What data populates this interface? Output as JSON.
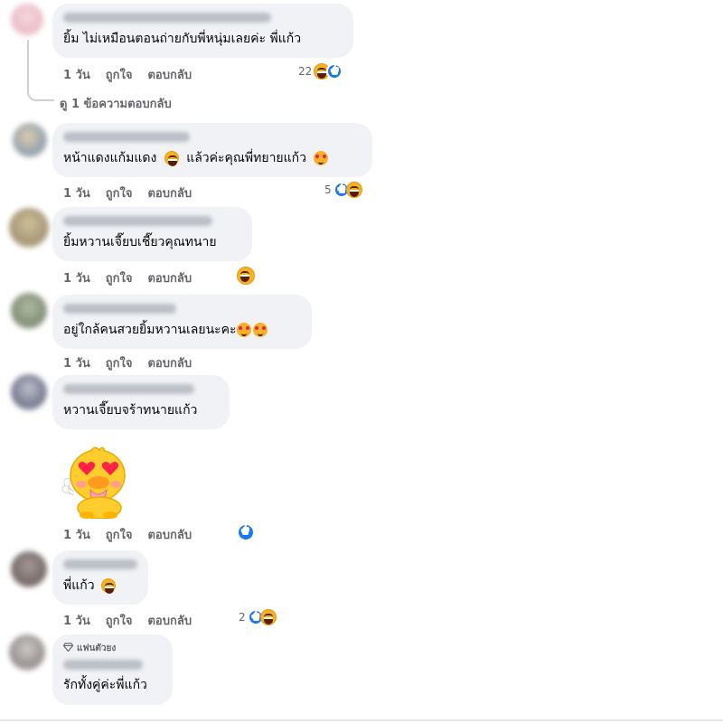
{
  "actions": {
    "time": "1 วัน",
    "like": "ถูกใจ",
    "reply": "ตอบกลับ"
  },
  "view_replies": "ดู 1 ข้อความตอบกลับ",
  "comments": [
    {
      "text": "ยิ้ม ไม่เหมือนตอนถ่ายกับพี่หนุ่มเลยค่ะ พี่แก้ว",
      "reaction_count": "22",
      "reactions": [
        "laugh-icon",
        "like-icon"
      ]
    },
    {
      "text": "หน้าแดงแก้มแดง",
      "text2": "แล้วค่ะคุณพี่ทยายแก้ว",
      "reaction_count": "5",
      "reactions": [
        "like-icon",
        "laugh-icon"
      ]
    },
    {
      "text": "ยิ้มหวานเจี๊ยบเชี๊ยวคุณทนาย",
      "reaction_count": "",
      "reactions": [
        "laugh-icon"
      ]
    },
    {
      "text": "อยู่ใกล้คนสวยยิ้มหวานเลยนะคะ",
      "reaction_count": "",
      "reactions": []
    },
    {
      "text": "หวานเจี๊ยบจร้าทนายแก้ว",
      "reaction_count": "",
      "reactions": [
        "like-icon"
      ],
      "sticker": "heart-eyes-duck-sticker"
    },
    {
      "text": "พี่แก้ว",
      "reaction_count": "2",
      "reactions": [
        "like-icon",
        "laugh-icon"
      ]
    },
    {
      "text": "รักทั้งคู่ค่ะพี่แก้ว",
      "badge": "แฟนตัวยง",
      "badge_icon": "diamond-icon"
    }
  ],
  "colors": {
    "bubble": "#f0f2f5",
    "meta": "#65676b",
    "like_blue": "#1877f2",
    "laugh_yellow": "#f7b125"
  }
}
